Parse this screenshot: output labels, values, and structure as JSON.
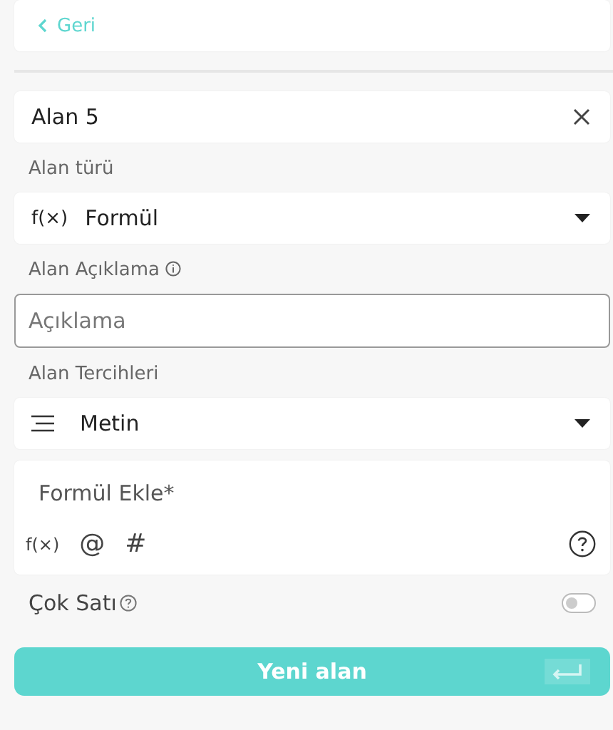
{
  "back_link": {
    "label": "Geri"
  },
  "name_field": {
    "value": "Alan 5"
  },
  "field_type": {
    "label": "Alan türü",
    "icon": "f(×)",
    "value": "Formül"
  },
  "description": {
    "label": "Alan Açıklama",
    "placeholder": "Açıklama"
  },
  "preferences": {
    "label": "Alan Tercihleri",
    "value": "Metin"
  },
  "formula": {
    "placeholder": "Formül Ekle*",
    "tools": [
      {
        "kind": "function",
        "text": "f(×)"
      },
      {
        "kind": "mention",
        "text": "@"
      },
      {
        "kind": "hashtag",
        "text": "#"
      }
    ]
  },
  "multiline": {
    "label": "Çok Satı",
    "on": false
  },
  "submit": {
    "label": "Yeni alan"
  }
}
